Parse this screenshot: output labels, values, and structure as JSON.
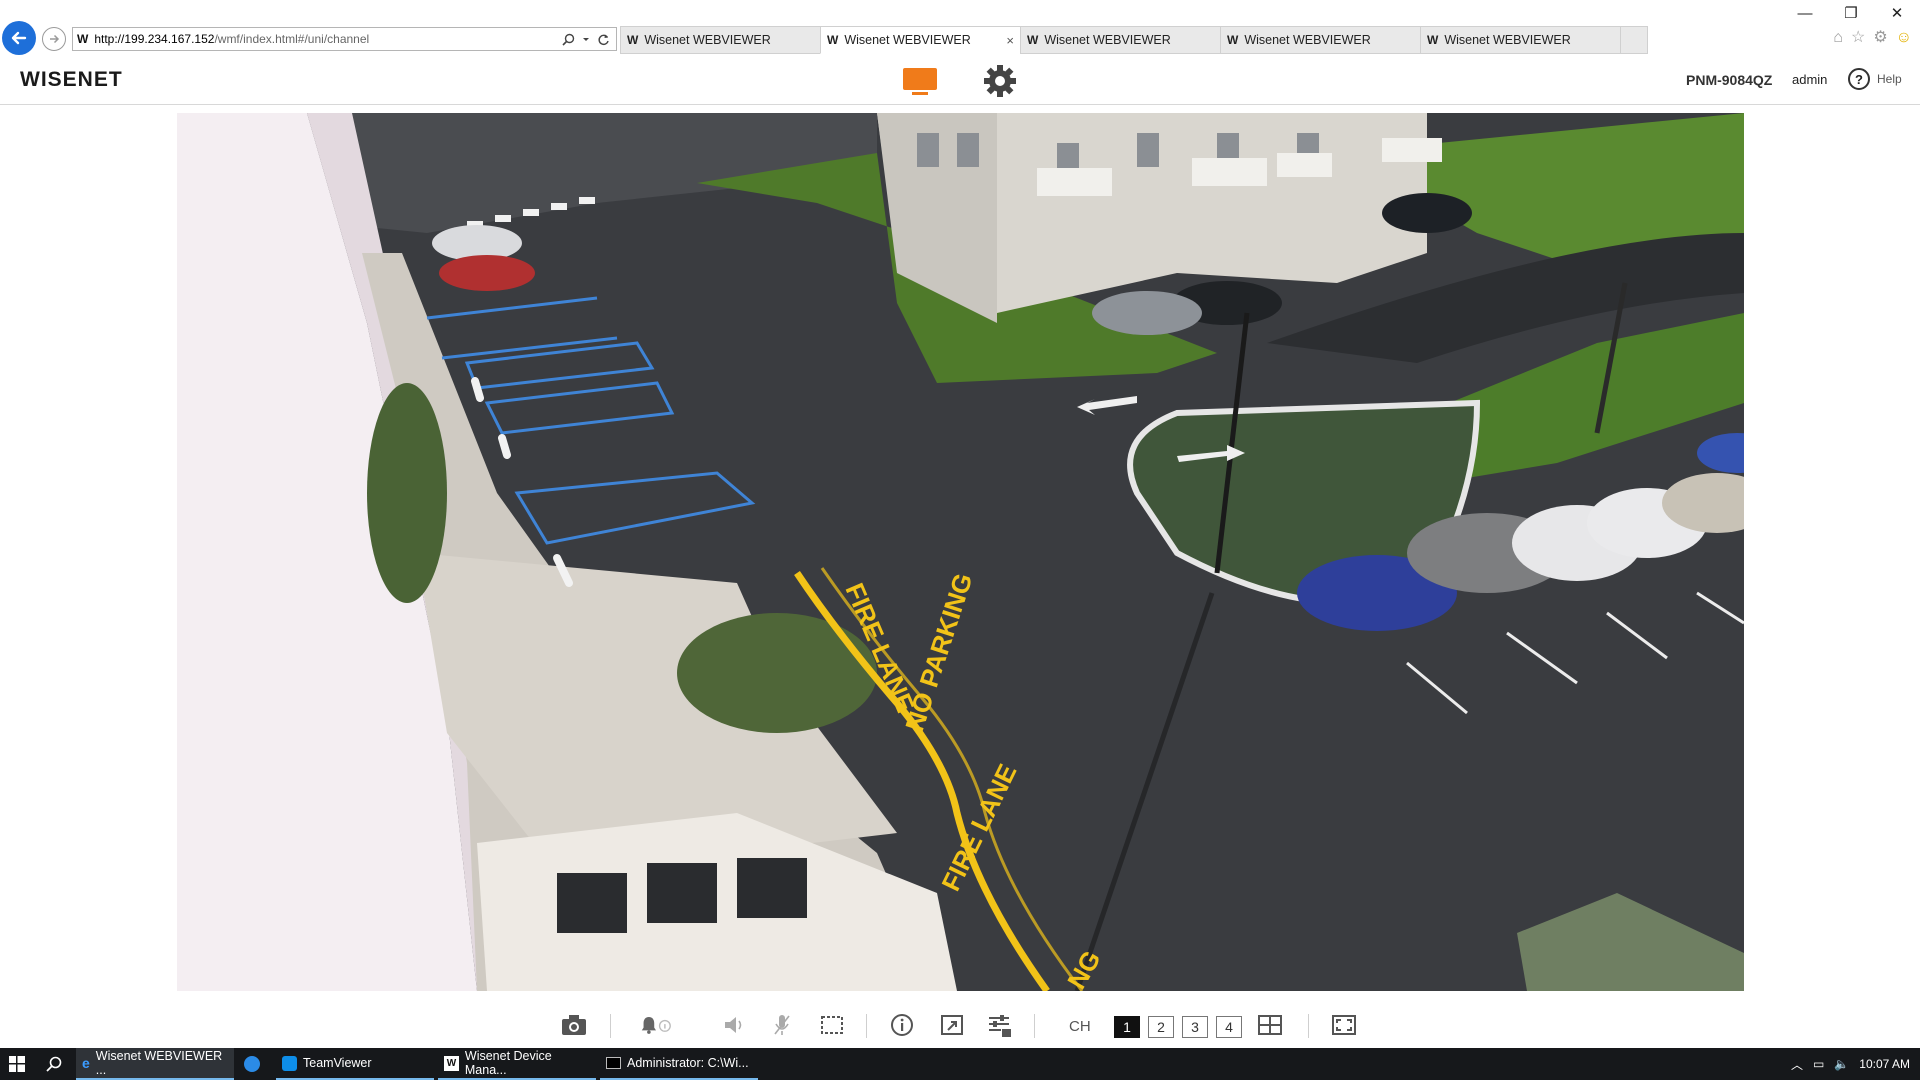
{
  "browser": {
    "address_site_letter": "W",
    "url_host": "http://199.234.167.152",
    "url_path": "/wmf/index.html#/uni/channel",
    "tabs": [
      {
        "icon": "W",
        "label": "Wisenet WEBVIEWER",
        "active": false
      },
      {
        "icon": "W",
        "label": "Wisenet WEBVIEWER",
        "active": true,
        "close": "×"
      },
      {
        "icon": "W",
        "label": "Wisenet WEBVIEWER",
        "active": false
      },
      {
        "icon": "W",
        "label": "Wisenet WEBVIEWER",
        "active": false
      },
      {
        "icon": "W",
        "label": "Wisenet WEBVIEWER",
        "active": false
      }
    ],
    "window_controls": {
      "minimize": "—",
      "restore": "❐",
      "close": "✕"
    },
    "tools": [
      "home-icon",
      "star-icon",
      "gear-icon",
      "smiley-icon"
    ]
  },
  "app": {
    "logo": "WISENET",
    "model": "PNM-9084QZ",
    "user": "admin",
    "help_label": "Help",
    "help_icon": "?",
    "accent_color": "#f07b1a"
  },
  "video": {
    "markings": {
      "fire_lane_1": "FIRE LANE",
      "no_parking": "NO PARKING",
      "fire_lane_2": "FIRE LANE",
      "fire_lane_partial": "NG"
    }
  },
  "controls": {
    "ch_label": "CH",
    "channels": [
      "1",
      "2",
      "3",
      "4"
    ],
    "active_channel": "1"
  },
  "taskbar": {
    "items": [
      {
        "label": "Wisenet WEBVIEWER ...",
        "icon": "ie-icon",
        "state": "active"
      },
      {
        "label": "",
        "icon": "edge-icon",
        "state": "pinned"
      },
      {
        "label": "TeamViewer",
        "icon": "teamviewer-icon",
        "state": "open"
      },
      {
        "label": "Wisenet Device Mana...",
        "icon": "wisenet-icon",
        "state": "open"
      },
      {
        "label": "Administrator: C:\\Wi...",
        "icon": "cmd-icon",
        "state": "open"
      }
    ],
    "time": "10:07 AM"
  }
}
